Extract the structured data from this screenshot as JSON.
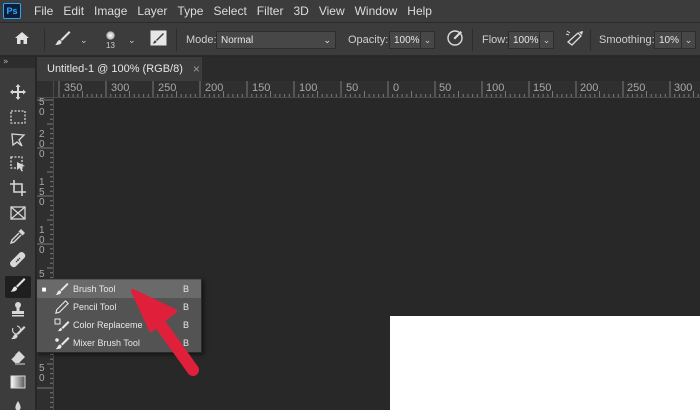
{
  "app": {
    "logo": "Ps"
  },
  "menu": [
    "File",
    "Edit",
    "Image",
    "Layer",
    "Type",
    "Select",
    "Filter",
    "3D",
    "View",
    "Window",
    "Help"
  ],
  "options": {
    "brush_size": "13",
    "mode_label": "Mode:",
    "mode_value": "Normal",
    "opacity_label": "Opacity:",
    "opacity_value": "100%",
    "flow_label": "Flow:",
    "flow_value": "100%",
    "smoothing_label": "Smoothing:",
    "smoothing_value": "10%"
  },
  "toolbar": {
    "collapse_glyph": "»"
  },
  "document": {
    "tab_title": "Untitled-1 @ 100% (RGB/8)",
    "close_glyph": "×"
  },
  "ruler": {
    "h": [
      "350",
      "300",
      "250",
      "200",
      "150",
      "100",
      "50",
      "0",
      "50",
      "100",
      "150",
      "200",
      "250",
      "300"
    ],
    "v": [
      "5\n0",
      "2\n0\n0",
      "1\n5\n0",
      "1\n0\n0",
      "5",
      "5\n0"
    ]
  },
  "flyout": {
    "items": [
      {
        "label": "Brush Tool",
        "shortcut": "B",
        "selected": true,
        "icon": "brush-icon"
      },
      {
        "label": "Pencil Tool",
        "shortcut": "B",
        "selected": false,
        "icon": "pencil-icon"
      },
      {
        "label": "Color Replaceme",
        "shortcut": "B",
        "selected": false,
        "icon": "color-replacement-icon"
      },
      {
        "label": "Mixer Brush Tool",
        "shortcut": "B",
        "selected": false,
        "icon": "mixer-brush-icon"
      }
    ]
  },
  "colors": {
    "accent_arrow": "#e0203a",
    "canvas": "#ffffff",
    "workspace": "#282828",
    "panel": "#3c3c3c"
  }
}
